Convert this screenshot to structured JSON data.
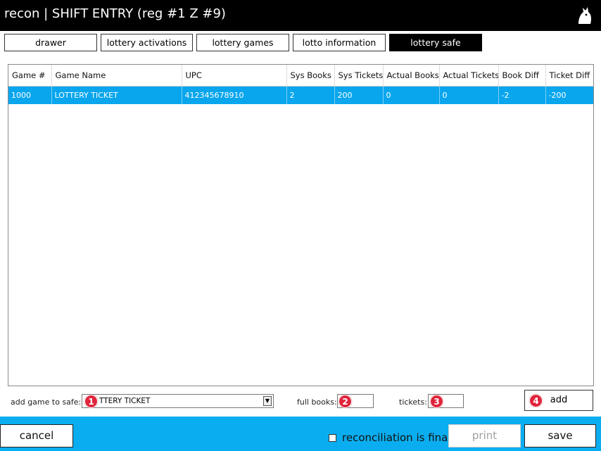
{
  "window": {
    "title": "recon | SHIFT ENTRY  (reg #1  Z #9)",
    "logo_icon": "white-bird-logo-icon"
  },
  "tabs": [
    {
      "label": "drawer",
      "active": false
    },
    {
      "label": "lottery activations",
      "active": false
    },
    {
      "label": "lottery games",
      "active": false
    },
    {
      "label": "lotto information",
      "active": false
    },
    {
      "label": "lottery safe",
      "active": true
    }
  ],
  "grid": {
    "columns": [
      "Game #",
      "Game Name",
      "UPC",
      "Sys Books",
      "Sys Tickets",
      "Actual Books",
      "Actual Tickets",
      "Book Diff",
      "Ticket Diff"
    ],
    "rows": [
      {
        "selected": true,
        "cells": [
          "1000",
          "LOTTERY TICKET",
          "412345678910",
          "2",
          "200",
          "0",
          "0",
          "-2",
          "-200"
        ]
      }
    ]
  },
  "form": {
    "add_game_label": "add game to safe:",
    "selected_game": "TTERY TICKET",
    "full_books_label": "full books:",
    "full_books_value": "",
    "tickets_label": "tickets:",
    "tickets_value": "",
    "add_label": "add"
  },
  "markers": [
    "1",
    "2",
    "3",
    "4"
  ],
  "footer": {
    "cancel_label": "cancel",
    "reconciliation_label": "reconciliation is final",
    "reconciliation_checked": false,
    "print_label": "print",
    "save_label": "save"
  },
  "colors": {
    "titlebar": "#000000",
    "footer": "#0aaef0",
    "selection": "#09a6ee",
    "marker": "#e0243c"
  }
}
